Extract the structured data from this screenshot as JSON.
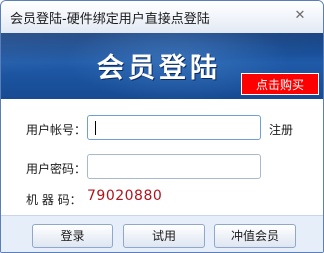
{
  "window": {
    "title": "会员登陆-硬件绑定用户直接点登陆",
    "close_glyph": "✕"
  },
  "banner": {
    "title": "会员登陆",
    "buy_button": "点击购买",
    "buy_color": "#ff0000"
  },
  "form": {
    "account_label": "用户帐号：",
    "account_value": "",
    "register_link": "注册",
    "password_label": "用户密码：",
    "password_value": "",
    "machine_label": "机 器 码：",
    "machine_code": "79020880",
    "machine_code_color": "#b0131d"
  },
  "buttons": {
    "login": "登录",
    "trial": "试用",
    "recharge": "冲值会员"
  },
  "icons": {
    "close": "close-icon"
  }
}
